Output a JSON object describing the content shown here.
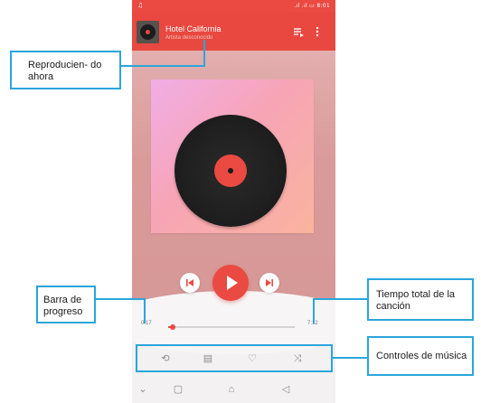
{
  "status_bar": {
    "notification_icon": "music-note-icon",
    "right_text": ".ıl .ıl ▭ 8:01"
  },
  "now_playing": {
    "title": "Hotel California",
    "artist": "Artista desconocido",
    "queue_icon": "queue-icon",
    "more_icon": "more-vert-icon"
  },
  "player": {
    "prev_icon": "skip-previous-icon",
    "play_icon": "play-icon",
    "next_icon": "skip-next-icon"
  },
  "progress": {
    "elapsed": "0:17",
    "total": "7:12",
    "fraction": 0.039
  },
  "controls": [
    {
      "icon": "repeat-icon",
      "glyph": "⟲"
    },
    {
      "icon": "lyrics-icon",
      "glyph": "▤"
    },
    {
      "icon": "heart-icon",
      "glyph": "♡"
    },
    {
      "icon": "shuffle-icon",
      "glyph": "⤨"
    }
  ],
  "nav": [
    {
      "icon": "chevron-down-icon",
      "glyph": "⌄"
    },
    {
      "icon": "recents-icon",
      "glyph": "▢"
    },
    {
      "icon": "home-icon",
      "glyph": "⌂"
    },
    {
      "icon": "back-icon",
      "glyph": "◁"
    }
  ],
  "annotations": {
    "now_playing": "Reproducien- do ahora",
    "progress_bar": "Barra de progreso",
    "total_time": "Tiempo total de la canción",
    "music_controls": "Controles de música"
  },
  "colors": {
    "accent": "#ea4a42",
    "annotation": "#2aa6dc"
  }
}
